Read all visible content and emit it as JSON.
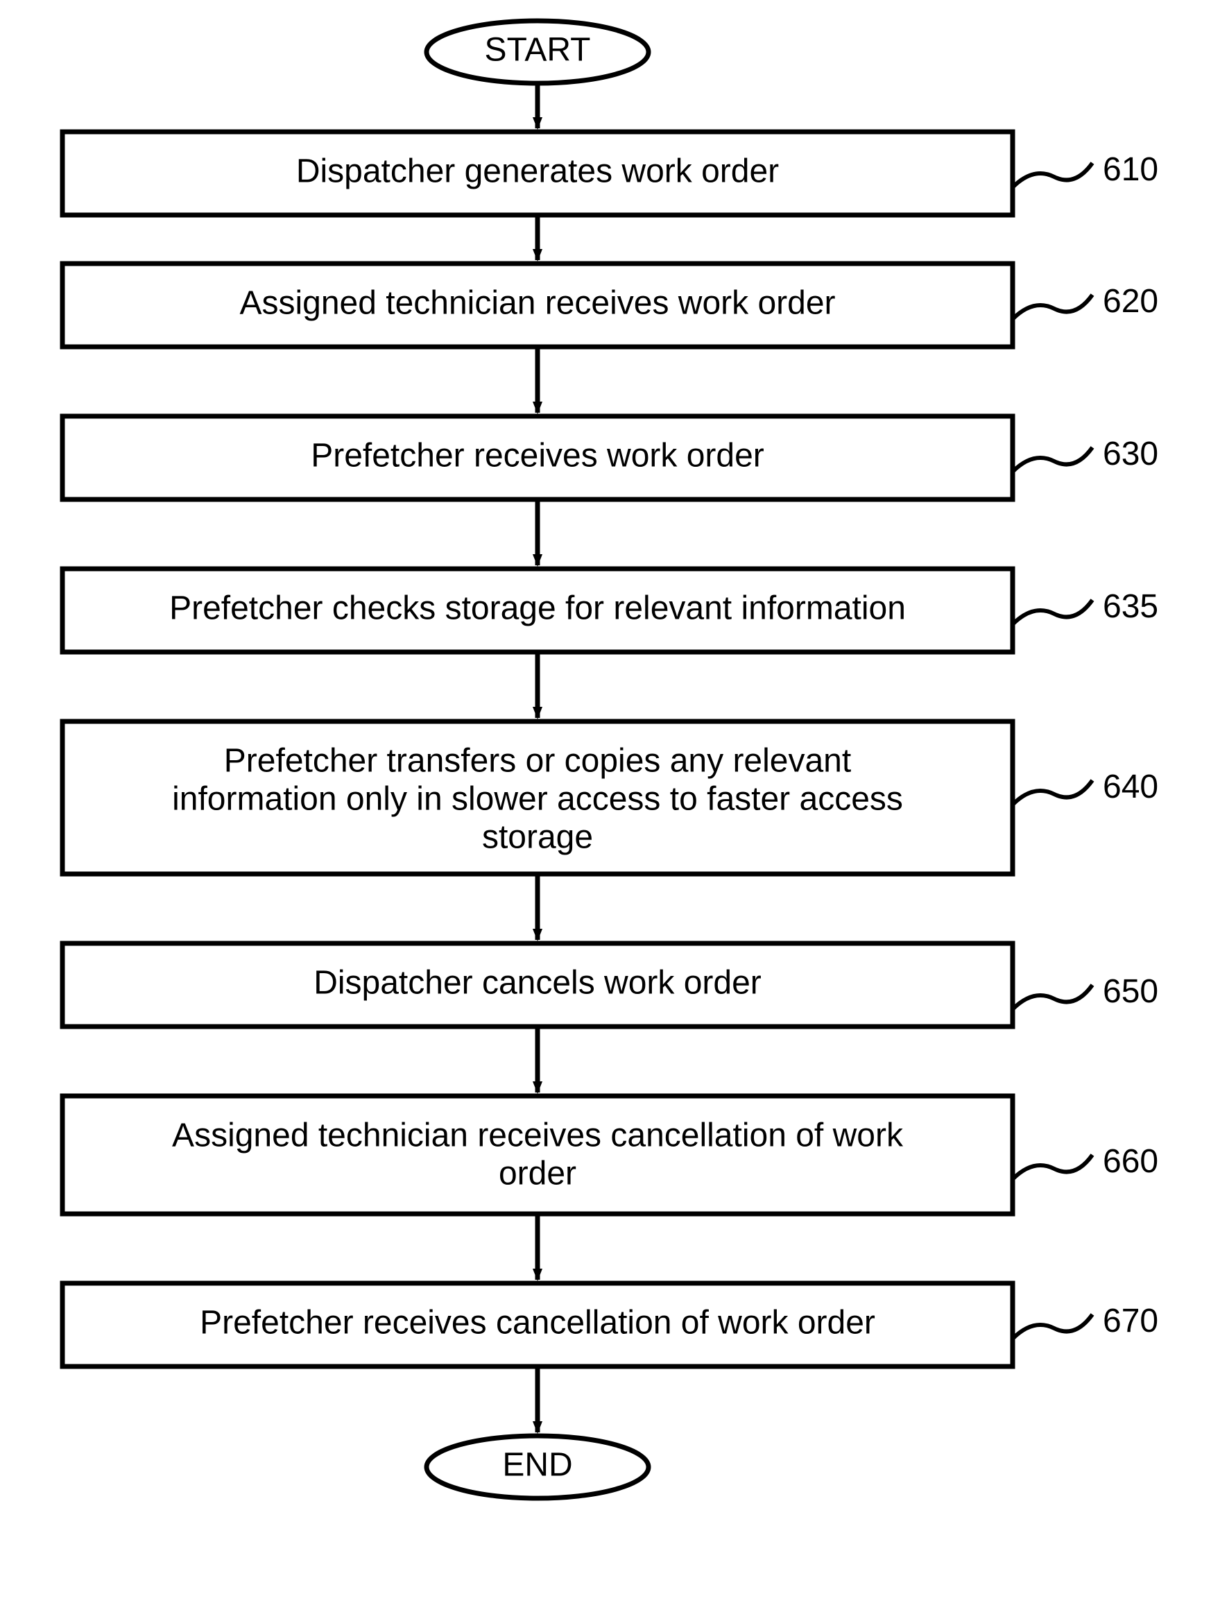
{
  "chart_data": {
    "type": "flowchart",
    "nodes": [
      {
        "id": "start",
        "shape": "terminator",
        "label": "START"
      },
      {
        "id": "610",
        "shape": "process",
        "label": "Dispatcher generates work order",
        "ref": "610"
      },
      {
        "id": "620",
        "shape": "process",
        "label": "Assigned technician receives work order",
        "ref": "620"
      },
      {
        "id": "630",
        "shape": "process",
        "label": "Prefetcher receives work order",
        "ref": "630"
      },
      {
        "id": "635",
        "shape": "process",
        "label": "Prefetcher checks storage for relevant information",
        "ref": "635"
      },
      {
        "id": "640",
        "shape": "process",
        "label": "Prefetcher transfers or copies any relevant information only in slower access to faster access storage",
        "ref": "640"
      },
      {
        "id": "650",
        "shape": "process",
        "label": "Dispatcher cancels work order",
        "ref": "650"
      },
      {
        "id": "660",
        "shape": "process",
        "label": "Assigned technician receives cancellation of work order",
        "ref": "660"
      },
      {
        "id": "670",
        "shape": "process",
        "label": "Prefetcher receives cancellation of work order",
        "ref": "670"
      },
      {
        "id": "end",
        "shape": "terminator",
        "label": "END"
      }
    ],
    "edges": [
      [
        "start",
        "610"
      ],
      [
        "610",
        "620"
      ],
      [
        "620",
        "630"
      ],
      [
        "630",
        "635"
      ],
      [
        "635",
        "640"
      ],
      [
        "640",
        "650"
      ],
      [
        "650",
        "660"
      ],
      [
        "660",
        "670"
      ],
      [
        "670",
        "end"
      ]
    ]
  },
  "terminators": {
    "start": "START",
    "end": "END"
  },
  "steps": {
    "s610": {
      "text": "Dispatcher generates work order",
      "ref": "610"
    },
    "s620": {
      "text": "Assigned technician receives work order",
      "ref": "620"
    },
    "s630": {
      "text": "Prefetcher receives work order",
      "ref": "630"
    },
    "s635": {
      "text": "Prefetcher checks storage for relevant information",
      "ref": "635"
    },
    "s640": {
      "line1": "Prefetcher transfers or copies any relevant",
      "line2": "information only in slower access to faster access",
      "line3": "storage",
      "ref": "640"
    },
    "s650": {
      "text": "Dispatcher cancels work order",
      "ref": "650"
    },
    "s660": {
      "line1": "Assigned technician receives cancellation of work",
      "line2": "order",
      "ref": "660"
    },
    "s670": {
      "text": "Prefetcher receives cancellation of work order",
      "ref": "670"
    }
  }
}
